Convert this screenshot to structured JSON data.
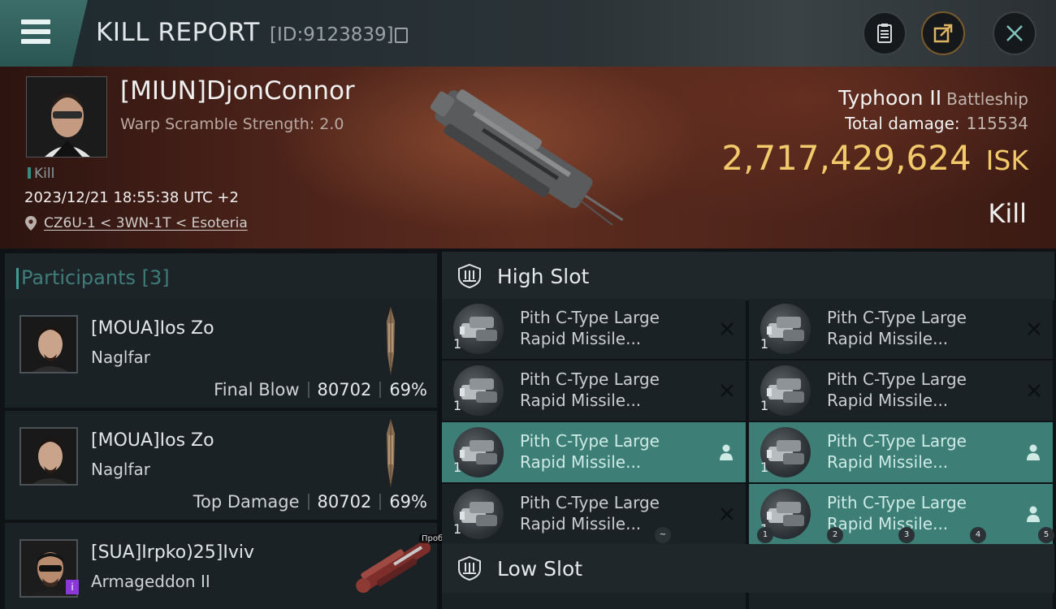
{
  "header": {
    "title": "KILL REPORT",
    "report_id": "[ID:9123839]",
    "icons": [
      "menu-icon",
      "copy-icon",
      "clipboard-icon",
      "share-icon",
      "close-icon"
    ]
  },
  "victim": {
    "name": "[MIUN]DjonConnor",
    "subtitle": "Warp Scramble Strength: 2.0",
    "kill_tag": "Kill",
    "timestamp": "2023/12/21 18:55:38 UTC +2",
    "location": "CZ6U-1 < 3WN-1T < Esoteria",
    "ship_name": "Typhoon II",
    "ship_class": "Battleship",
    "total_damage_label": "Total damage:",
    "total_damage": "115534",
    "isk_value": "2,717,429,624",
    "isk_unit": "ISK",
    "result": "Kill"
  },
  "participants": {
    "header": "Participants [3]",
    "rows": [
      {
        "name": "[MOUA]Ios Zo",
        "ship": "Naglfar",
        "role": "Final Blow",
        "damage": "80702",
        "percent": "69%"
      },
      {
        "name": "[MOUA]Ios Zo",
        "ship": "Naglfar",
        "role": "Top Damage",
        "damage": "80702",
        "percent": "69%"
      },
      {
        "name": "[SUA]Irpko)25]Iviv",
        "ship": "Armageddon II",
        "badge": "i",
        "hotkey": "Пробел"
      }
    ]
  },
  "high_slot": {
    "title": "High Slot",
    "modules": [
      {
        "name": "Pith C-Type Large Rapid Missile...",
        "qty": "1",
        "state": "destroyed"
      },
      {
        "name": "Pith C-Type Large Rapid Missile...",
        "qty": "1",
        "state": "destroyed"
      },
      {
        "name": "Pith C-Type Large Rapid Missile...",
        "qty": "1",
        "state": "destroyed"
      },
      {
        "name": "Pith C-Type Large Rapid Missile...",
        "qty": "1",
        "state": "destroyed"
      },
      {
        "name": "Pith C-Type Large Rapid Missile...",
        "qty": "1",
        "state": "dropped"
      },
      {
        "name": "Pith C-Type Large Rapid Missile...",
        "qty": "1",
        "state": "dropped"
      },
      {
        "name": "Pith C-Type Large Rapid Missile...",
        "qty": "1",
        "state": "destroyed"
      },
      {
        "name": "Pith C-Type Large Rapid Missile...",
        "qty": "1",
        "state": "dropped"
      }
    ],
    "number_badges": [
      "~",
      "1",
      "2",
      "3",
      "4",
      "5"
    ]
  },
  "low_slot": {
    "title": "Low Slot"
  },
  "colors": {
    "accent": "#3d7f77",
    "isk": "#f2c96b",
    "participants_header": "#3e7d7a"
  }
}
